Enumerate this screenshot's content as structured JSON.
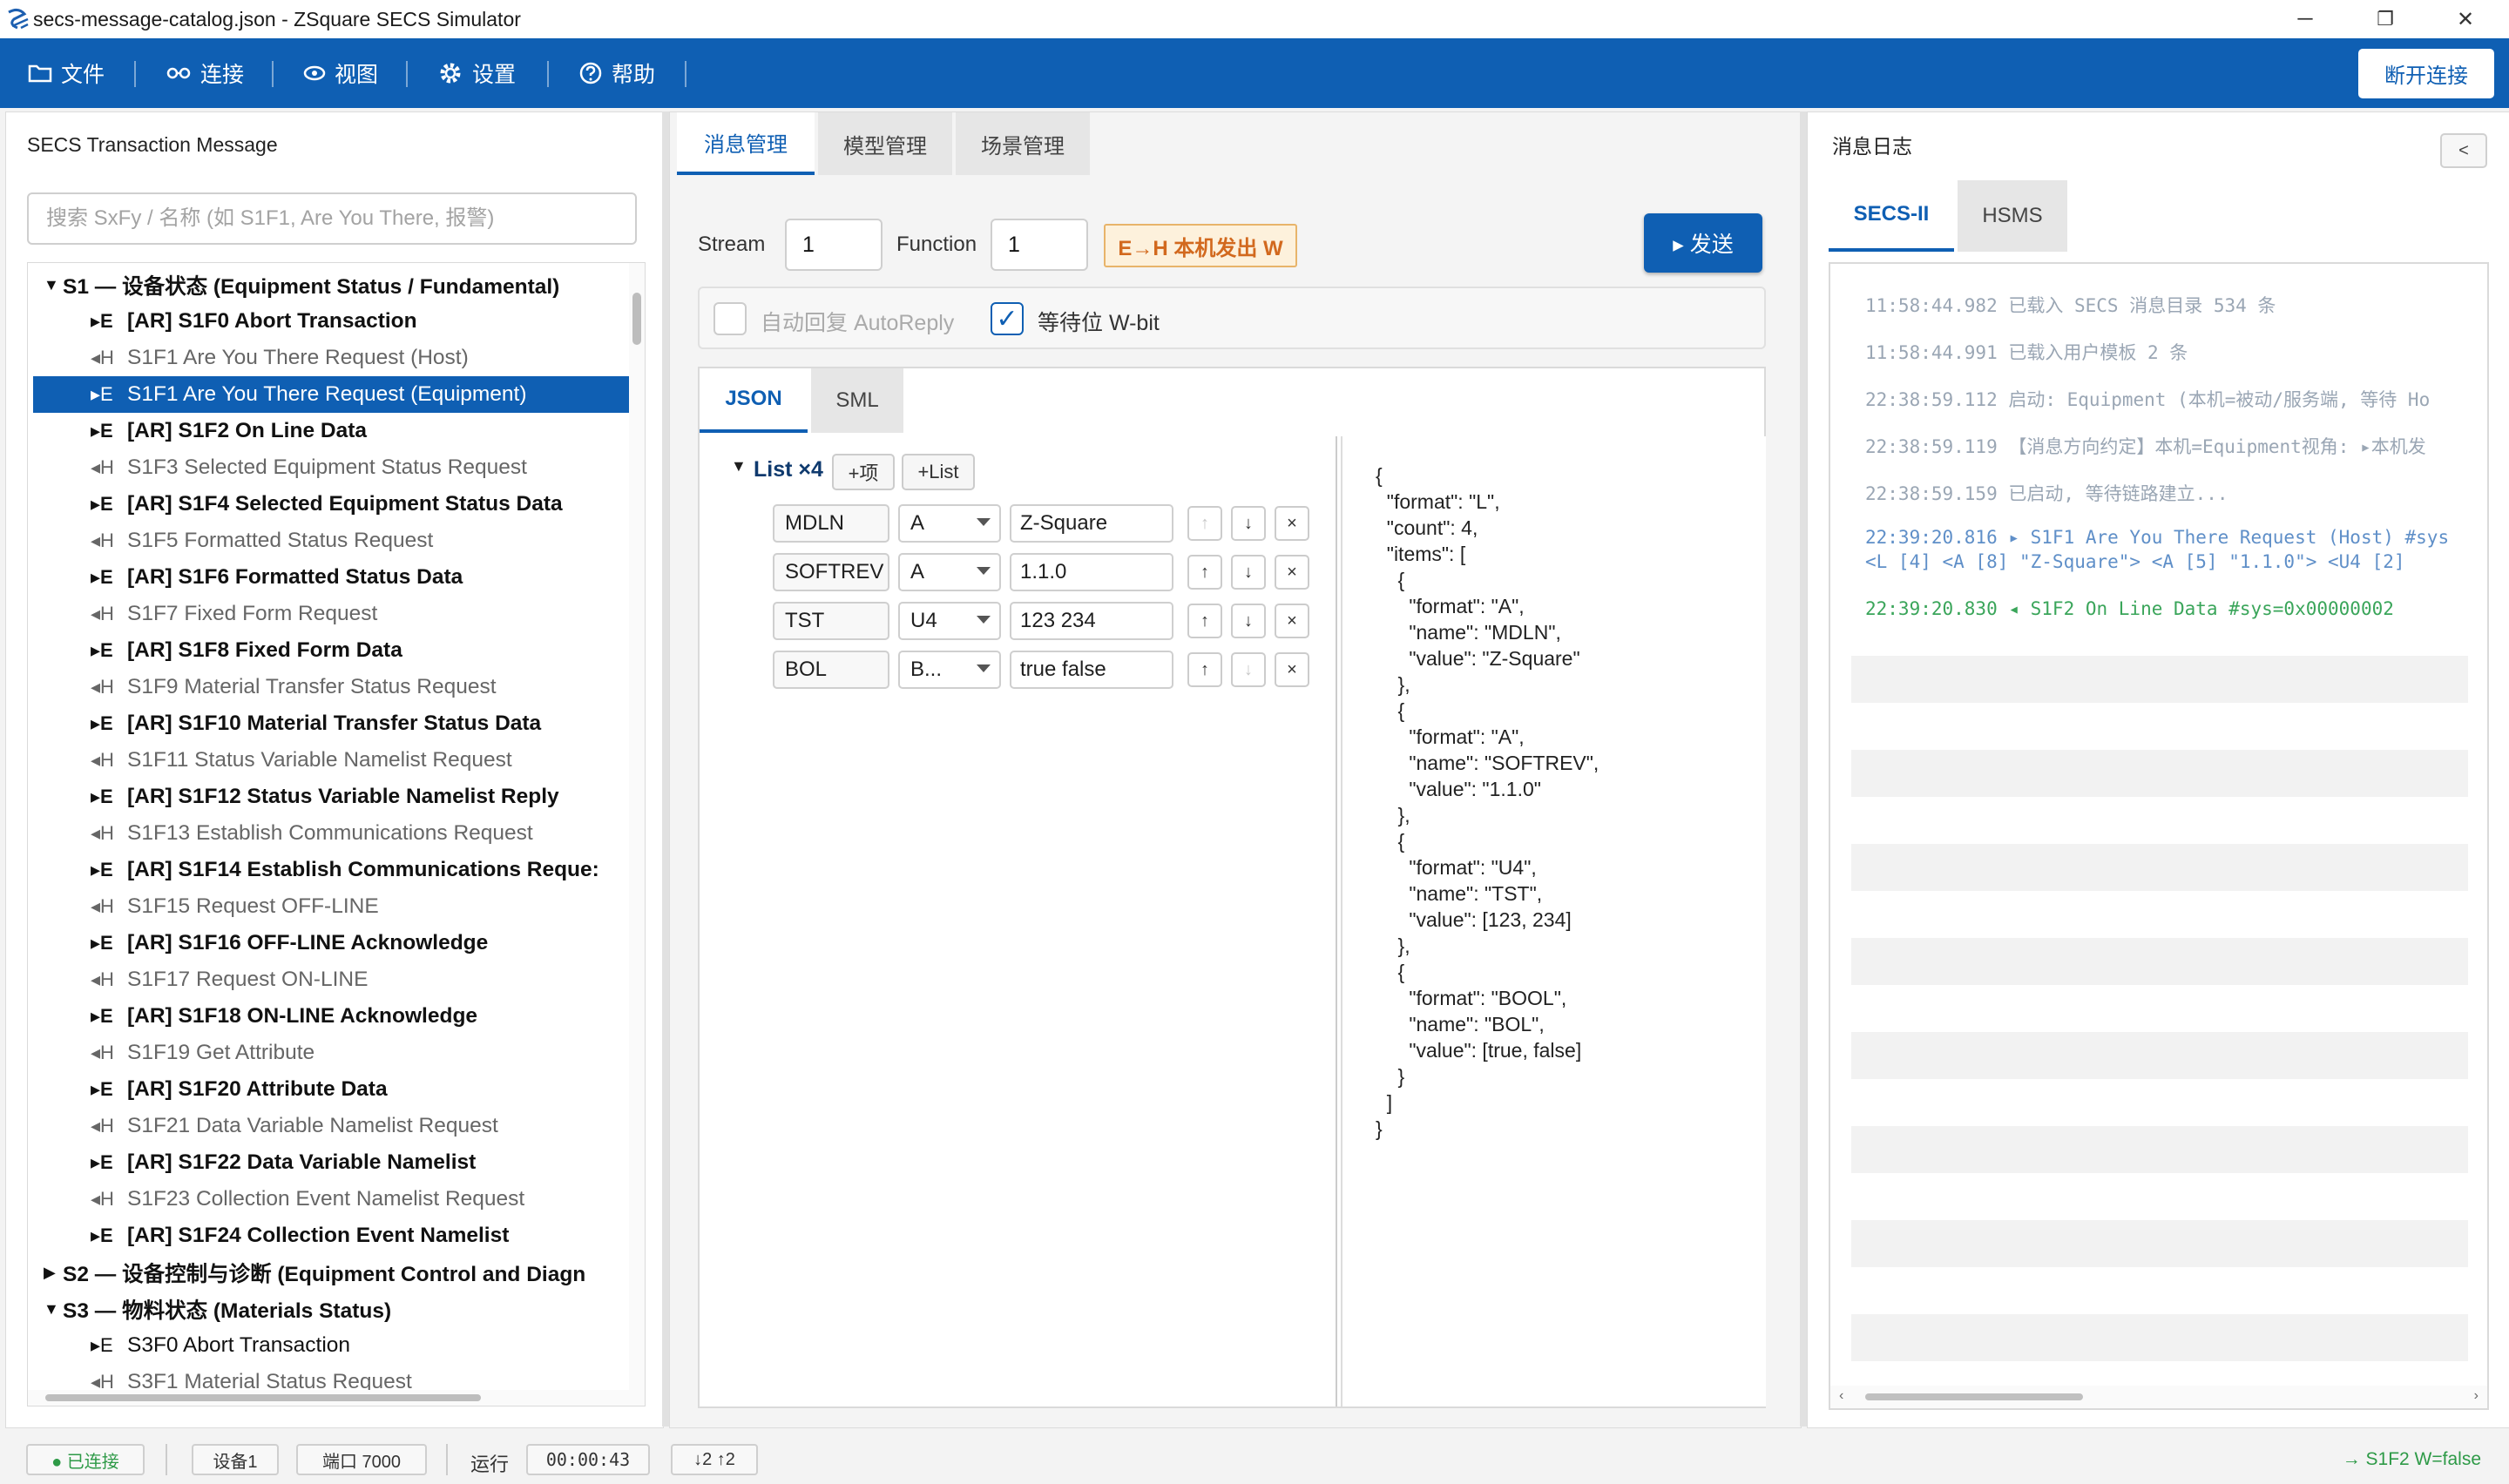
{
  "window": {
    "title": "secs-message-catalog.json - ZSquare SECS Simulator",
    "controls": {
      "minimize": "─",
      "restore": "❐",
      "close": "✕"
    }
  },
  "menu": {
    "items": [
      {
        "label": "文件",
        "icon": "folder-icon"
      },
      {
        "label": "连接",
        "icon": "link-icon"
      },
      {
        "label": "视图",
        "icon": "eye-icon"
      },
      {
        "label": "设置",
        "icon": "gear-icon"
      },
      {
        "label": "帮助",
        "icon": "help-icon"
      }
    ],
    "disconnect_label": "断开连接"
  },
  "left": {
    "title": "SECS Transaction Message",
    "search_placeholder": "搜索 SxFy / 名称 (如 S1F1, Are You There, 报警)",
    "tree": [
      {
        "kind": "group",
        "caret": "▼",
        "text": "S1 — 设备状态 (Equipment Status / Fundamental)"
      },
      {
        "kind": "eq",
        "dir": "▸E",
        "text": "[AR] S1F0  Abort Transaction"
      },
      {
        "kind": "host",
        "dir": "◂H",
        "text": "S1F1  Are You There Request (Host)"
      },
      {
        "kind": "sel",
        "dir": "▸E",
        "text": "S1F1  Are You There Request (Equipment)"
      },
      {
        "kind": "eq",
        "dir": "▸E",
        "text": "[AR] S1F2  On Line Data"
      },
      {
        "kind": "host",
        "dir": "◂H",
        "text": "S1F3  Selected Equipment Status Request"
      },
      {
        "kind": "eq",
        "dir": "▸E",
        "text": "[AR] S1F4  Selected Equipment Status Data"
      },
      {
        "kind": "host",
        "dir": "◂H",
        "text": "S1F5  Formatted Status Request"
      },
      {
        "kind": "eq",
        "dir": "▸E",
        "text": "[AR] S1F6  Formatted Status Data"
      },
      {
        "kind": "host",
        "dir": "◂H",
        "text": "S1F7  Fixed Form Request"
      },
      {
        "kind": "eq",
        "dir": "▸E",
        "text": "[AR] S1F8  Fixed Form Data"
      },
      {
        "kind": "host",
        "dir": "◂H",
        "text": "S1F9  Material Transfer Status Request"
      },
      {
        "kind": "eq",
        "dir": "▸E",
        "text": "[AR] S1F10  Material Transfer Status Data"
      },
      {
        "kind": "host",
        "dir": "◂H",
        "text": "S1F11  Status Variable Namelist Request"
      },
      {
        "kind": "eq",
        "dir": "▸E",
        "text": "[AR] S1F12  Status Variable Namelist Reply"
      },
      {
        "kind": "host",
        "dir": "◂H",
        "text": "S1F13  Establish Communications Request"
      },
      {
        "kind": "eq",
        "dir": "▸E",
        "text": "[AR] S1F14  Establish Communications Reque:"
      },
      {
        "kind": "host",
        "dir": "◂H",
        "text": "S1F15  Request OFF-LINE"
      },
      {
        "kind": "eq",
        "dir": "▸E",
        "text": "[AR] S1F16  OFF-LINE Acknowledge"
      },
      {
        "kind": "host",
        "dir": "◂H",
        "text": "S1F17  Request ON-LINE"
      },
      {
        "kind": "eq",
        "dir": "▸E",
        "text": "[AR] S1F18  ON-LINE Acknowledge"
      },
      {
        "kind": "host",
        "dir": "◂H",
        "text": "S1F19  Get Attribute"
      },
      {
        "kind": "eq",
        "dir": "▸E",
        "text": "[AR] S1F20  Attribute Data"
      },
      {
        "kind": "host",
        "dir": "◂H",
        "text": "S1F21  Data Variable Namelist Request"
      },
      {
        "kind": "eq",
        "dir": "▸E",
        "text": "[AR] S1F22  Data Variable Namelist"
      },
      {
        "kind": "host",
        "dir": "◂H",
        "text": "S1F23  Collection Event Namelist Request"
      },
      {
        "kind": "eq",
        "dir": "▸E",
        "text": "[AR] S1F24  Collection Event Namelist"
      },
      {
        "kind": "group",
        "caret": "▶",
        "text": "S2 — 设备控制与诊断 (Equipment Control and Diagn"
      },
      {
        "kind": "group",
        "caret": "▼",
        "text": "S3 — 物料状态 (Materials Status)"
      },
      {
        "kind": "plain",
        "dir": "▸E",
        "text": "S3F0  Abort Transaction"
      },
      {
        "kind": "host",
        "dir": "◂H",
        "text": "S3F1  Material Status Request"
      }
    ]
  },
  "mid": {
    "tabs": [
      "消息管理",
      "模型管理",
      "场景管理"
    ],
    "stream_label": "Stream",
    "stream_value": "1",
    "function_label": "Function",
    "function_value": "1",
    "direction_badge": "E→H 本机发出 W",
    "send_label": "▸ 发送",
    "autoreply_label": "自动回复 AutoReply",
    "autoreply_checked": false,
    "wbit_label": "等待位 W-bit",
    "wbit_checked": true,
    "check_mark": "✓",
    "subtabs": [
      "JSON",
      "SML"
    ],
    "list_label": "List ×4",
    "add_item_label": "+项",
    "add_list_label": "+List",
    "items": [
      {
        "name": "MDLN",
        "format": "A",
        "value": "Z-Square"
      },
      {
        "name": "SOFTREV",
        "format": "A",
        "value": "1.1.0"
      },
      {
        "name": "TST",
        "format": "U4",
        "value": "123 234"
      },
      {
        "name": "BOL",
        "format": "B...",
        "value": "true false"
      }
    ],
    "btn_up": "↑",
    "btn_down": "↓",
    "btn_remove": "×",
    "json_text": "{\n  \"format\": \"L\",\n  \"count\": 4,\n  \"items\": [\n    {\n      \"format\": \"A\",\n      \"name\": \"MDLN\",\n      \"value\": \"Z-Square\"\n    },\n    {\n      \"format\": \"A\",\n      \"name\": \"SOFTREV\",\n      \"value\": \"1.1.0\"\n    },\n    {\n      \"format\": \"U4\",\n      \"name\": \"TST\",\n      \"value\": [123, 234]\n    },\n    {\n      \"format\": \"BOOL\",\n      \"name\": \"BOL\",\n      \"value\": [true, false]\n    }\n  ]\n}"
  },
  "right": {
    "title": "消息日志",
    "collapse_label": "<",
    "tabs": [
      "SECS-II",
      "HSMS"
    ],
    "log": [
      {
        "text": "11:58:44.982 已载入 SECS 消息目录 534 条",
        "color": "#9aa6b4"
      },
      {
        "text": "11:58:44.991 已载入用户模板 2 条",
        "color": "#9aa6b4"
      },
      {
        "text": "22:38:59.112 启动: Equipment (本机=被动/服务端, 等待 Ho",
        "color": "#9aa6b4"
      },
      {
        "text": "22:38:59.119 【消息方向约定】本机=Equipment视角: ▸本机发",
        "color": "#9aa6b4"
      },
      {
        "text": "22:38:59.159 已启动, 等待链路建立...",
        "color": "#9aa6b4"
      },
      {
        "text": "22:39:20.816 ▸ S1F1 Are You There Request (Host) #sys",
        "color": "#5f8fc8"
      },
      {
        "text": "   <L [4] <A [8] \"Z-Square\"> <A [5] \"1.1.0\"> <U4 [2]",
        "color": "#5f8fc8"
      },
      {
        "text": "22:39:20.830 ◂ S1F2 On Line Data #sys=0x00000002",
        "color": "#3aa55a"
      }
    ]
  },
  "status": {
    "connected": "● 已连接",
    "device": "设备1",
    "port": "端口 7000",
    "run_label": "运行",
    "runtime": "00:00:43",
    "counts": "↓2 ↑2",
    "last": "→ S1F2 W=false"
  },
  "colors": {
    "accent": "#0f5fb3",
    "badge_bg": "#fdf1dc",
    "badge_text": "#d2691e",
    "connected": "#2e9a47"
  }
}
